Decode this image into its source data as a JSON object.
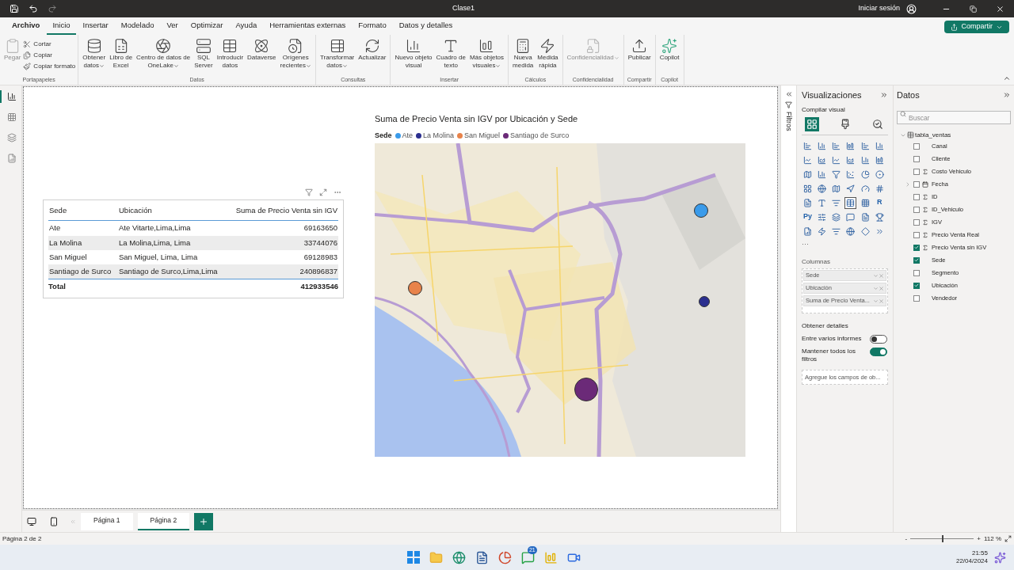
{
  "title_bar": {
    "title": "Clase1",
    "sign_in": "Iniciar sesión"
  },
  "menu_tabs": [
    {
      "label": "Archivo",
      "selected": false,
      "bold": true
    },
    {
      "label": "Inicio",
      "selected": true,
      "bold": false
    },
    {
      "label": "Insertar",
      "selected": false,
      "bold": false
    },
    {
      "label": "Modelado",
      "selected": false,
      "bold": false
    },
    {
      "label": "Ver",
      "selected": false,
      "bold": false
    },
    {
      "label": "Optimizar",
      "selected": false,
      "bold": false
    },
    {
      "label": "Ayuda",
      "selected": false,
      "bold": false
    },
    {
      "label": "Herramientas externas",
      "selected": false,
      "bold": false
    },
    {
      "label": "Formato",
      "selected": false,
      "bold": false
    },
    {
      "label": "Datos y detalles",
      "selected": false,
      "bold": false
    }
  ],
  "share_button": "Compartir",
  "ribbon": [
    {
      "label": "Portapapeles",
      "items": [
        {
          "kind": "large",
          "lines": [
            "Pegar"
          ],
          "disabled": true,
          "dropdown": false
        },
        {
          "kind": "small",
          "lines": [
            "Cortar"
          ],
          "disabled": false
        },
        {
          "kind": "small",
          "lines": [
            "Copiar"
          ],
          "disabled": false
        },
        {
          "kind": "small",
          "lines": [
            "Copiar formato"
          ],
          "disabled": false
        }
      ]
    },
    {
      "label": "Datos",
      "items": [
        {
          "kind": "large",
          "lines": [
            "Obtener",
            "datos"
          ],
          "disabled": false,
          "dropdown": true
        },
        {
          "kind": "large",
          "lines": [
            "Libro de",
            "Excel"
          ],
          "disabled": false,
          "dropdown": false
        },
        {
          "kind": "large",
          "lines": [
            "Centro de datos de",
            "OneLake"
          ],
          "disabled": false,
          "dropdown": true
        },
        {
          "kind": "large",
          "lines": [
            "SQL",
            "Server"
          ],
          "disabled": false,
          "dropdown": false
        },
        {
          "kind": "large",
          "lines": [
            "Introducir",
            "datos"
          ],
          "disabled": false,
          "dropdown": false
        },
        {
          "kind": "large",
          "lines": [
            "Dataverse"
          ],
          "disabled": false,
          "dropdown": false
        },
        {
          "kind": "large",
          "lines": [
            "Orígenes",
            "recientes"
          ],
          "disabled": false,
          "dropdown": true
        }
      ]
    },
    {
      "label": "Consultas",
      "items": [
        {
          "kind": "large",
          "lines": [
            "Transformar",
            "datos"
          ],
          "disabled": false,
          "dropdown": true
        },
        {
          "kind": "large",
          "lines": [
            "Actualizar"
          ],
          "disabled": false,
          "dropdown": false
        }
      ]
    },
    {
      "label": "Insertar",
      "items": [
        {
          "kind": "large",
          "lines": [
            "Nuevo objeto",
            "visual"
          ],
          "disabled": false,
          "dropdown": false
        },
        {
          "kind": "large",
          "lines": [
            "Cuadro de",
            "texto"
          ],
          "disabled": false,
          "dropdown": false
        },
        {
          "kind": "large",
          "lines": [
            "Más objetos",
            "visuales"
          ],
          "disabled": false,
          "dropdown": true
        }
      ]
    },
    {
      "label": "Cálculos",
      "items": [
        {
          "kind": "large",
          "lines": [
            "Nueva",
            "medida"
          ],
          "disabled": false,
          "dropdown": false
        },
        {
          "kind": "large",
          "lines": [
            "Medida",
            "rápida"
          ],
          "disabled": false,
          "dropdown": false
        }
      ]
    },
    {
      "label": "Confidencialidad",
      "items": [
        {
          "kind": "large",
          "lines": [
            "Confidencialidad"
          ],
          "disabled": true,
          "dropdown": true
        }
      ]
    },
    {
      "label": "Compartir",
      "items": [
        {
          "kind": "large",
          "lines": [
            "Publicar"
          ],
          "disabled": false,
          "dropdown": false
        }
      ]
    },
    {
      "label": "Copilot",
      "items": [
        {
          "kind": "large",
          "lines": [
            "Copilot"
          ],
          "disabled": false,
          "dropdown": false
        }
      ]
    }
  ],
  "left_nav": [
    {
      "selected": true
    },
    {
      "selected": false
    },
    {
      "selected": false
    },
    {
      "selected": false
    }
  ],
  "table_visual": {
    "columns": [
      "Sede",
      "Ubicación",
      "Suma de Precio Venta sin IGV"
    ],
    "rows": [
      [
        "Ate",
        "Ate Vitarte,Lima,Lima",
        "69163650"
      ],
      [
        "La Molina",
        "La Molina,Lima, Lima",
        "33744076"
      ],
      [
        "San Miguel",
        "San Miguel, Lima, Lima",
        "69128983"
      ],
      [
        "Santiago de Surco",
        "Santiago de Surco,Lima,Lima",
        "240896837"
      ]
    ],
    "total": [
      "Total",
      "412933546"
    ]
  },
  "map_visual": {
    "title": "Suma de Precio Venta sin IGV por Ubicación y Sede",
    "legend_title": "Sede",
    "legend": [
      {
        "label": "Ate",
        "color": "#3a9bea"
      },
      {
        "label": "La Molina",
        "color": "#2b2f8f"
      },
      {
        "label": "San Miguel",
        "color": "#e8834a"
      },
      {
        "label": "Santiago de Surco",
        "color": "#6b2a78"
      }
    ]
  },
  "filters_label": "Filtros",
  "visualizations": {
    "title": "Visualizaciones",
    "subtitle": "Compilar visual",
    "tabs": [
      {
        "selected": true
      },
      {
        "selected": false
      },
      {
        "selected": false
      }
    ],
    "gallery": [
      {
        "kind": "icon",
        "selected": false
      },
      {
        "kind": "icon",
        "selected": false
      },
      {
        "kind": "icon",
        "selected": false
      },
      {
        "kind": "icon",
        "selected": false
      },
      {
        "kind": "icon",
        "selected": false
      },
      {
        "kind": "icon",
        "selected": false
      },
      {
        "kind": "icon",
        "selected": false
      },
      {
        "kind": "icon",
        "selected": false
      },
      {
        "kind": "icon",
        "selected": false
      },
      {
        "kind": "icon",
        "selected": false
      },
      {
        "kind": "icon",
        "selected": false
      },
      {
        "kind": "icon",
        "selected": false
      },
      {
        "kind": "icon",
        "selected": false
      },
      {
        "kind": "icon",
        "selected": false
      },
      {
        "kind": "icon",
        "selected": false
      },
      {
        "kind": "icon",
        "selected": false
      },
      {
        "kind": "icon",
        "selected": false
      },
      {
        "kind": "icon",
        "selected": false
      },
      {
        "kind": "icon",
        "selected": false
      },
      {
        "kind": "icon",
        "selected": false
      },
      {
        "kind": "icon",
        "selected": false
      },
      {
        "kind": "icon",
        "selected": false
      },
      {
        "kind": "icon",
        "selected": false
      },
      {
        "kind": "icon",
        "selected": false
      },
      {
        "kind": "icon",
        "selected": false
      },
      {
        "kind": "icon",
        "selected": false
      },
      {
        "kind": "icon",
        "selected": false
      },
      {
        "kind": "icon",
        "selected": true
      },
      {
        "kind": "icon",
        "selected": false
      },
      {
        "kind": "text",
        "text": "R",
        "selected": false
      },
      {
        "kind": "text",
        "text": "Py",
        "selected": false
      },
      {
        "kind": "icon",
        "selected": false
      },
      {
        "kind": "icon",
        "selected": false
      },
      {
        "kind": "icon",
        "selected": false
      },
      {
        "kind": "icon",
        "selected": false
      },
      {
        "kind": "icon",
        "selected": false
      },
      {
        "kind": "icon",
        "selected": false
      },
      {
        "kind": "icon",
        "selected": false
      },
      {
        "kind": "icon",
        "selected": false
      },
      {
        "kind": "icon",
        "selected": false
      },
      {
        "kind": "icon",
        "selected": false
      },
      {
        "kind": "icon",
        "selected": false
      }
    ],
    "more": "···",
    "columns_label": "Columnas",
    "column_fields": [
      "Sede",
      "Ubicación",
      "Suma de Precio Venta..."
    ],
    "details_label": "Obtener detalles",
    "toggles": [
      {
        "label": "Entre varios informes",
        "on": false
      },
      {
        "label": "Mantener todos los filtros",
        "on": true
      }
    ],
    "drill_placeholder": "Agregue los campos de ob..."
  },
  "data_pane": {
    "title": "Datos",
    "search_placeholder": "Buscar",
    "table": {
      "label": "tabla_ventas",
      "expanded": true,
      "children": [
        {
          "label": "Canal",
          "kind": "field",
          "checked": false
        },
        {
          "label": "Cliente",
          "kind": "field",
          "checked": false
        },
        {
          "label": "Costo Vehiculo",
          "kind": "sum",
          "checked": false
        },
        {
          "label": "Fecha",
          "kind": "hierarchy",
          "checked": false
        },
        {
          "label": "ID",
          "kind": "sum",
          "checked": false
        },
        {
          "label": "ID_Vehiculo",
          "kind": "sum",
          "checked": false
        },
        {
          "label": "IGV",
          "kind": "sum",
          "checked": false
        },
        {
          "label": "Precio Venta Real",
          "kind": "sum",
          "checked": false
        },
        {
          "label": "Precio Venta sin IGV",
          "kind": "sum",
          "checked": true
        },
        {
          "label": "Sede",
          "kind": "field",
          "checked": true
        },
        {
          "label": "Segmento",
          "kind": "field",
          "checked": false
        },
        {
          "label": "Ubicación",
          "kind": "field",
          "checked": true
        },
        {
          "label": "Vendedor",
          "kind": "field",
          "checked": false
        }
      ]
    }
  },
  "pages": [
    {
      "label": "Página 1",
      "selected": false
    },
    {
      "label": "Página 2",
      "selected": true
    }
  ],
  "status_bar": {
    "page_info": "Página 2 de 2",
    "zoom_minus": "-",
    "zoom_plus": "+",
    "zoom": "112 %",
    "zoom_slider": {
      "level": 0.5
    }
  },
  "taskbar": {
    "badge": "21",
    "time": "21:55",
    "date": "22/04/2024"
  }
}
